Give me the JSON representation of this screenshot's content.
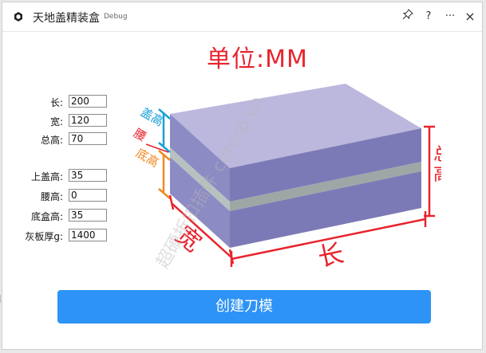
{
  "window": {
    "title": "天地盖精装盒",
    "build_tag": "Debug",
    "controls": {
      "pin": "pin-icon",
      "help": "?",
      "more": "···",
      "close": "×"
    }
  },
  "form": {
    "fields": [
      {
        "label": "长:",
        "value": "200"
      },
      {
        "label": "宽:",
        "value": "120"
      },
      {
        "label": "总高:",
        "value": "70"
      },
      {
        "label": "上盖高:",
        "value": "35"
      },
      {
        "label": "腰高:",
        "value": "0"
      },
      {
        "label": "底盒高:",
        "value": "35"
      },
      {
        "label": "灰板厚g:",
        "value": "1400"
      }
    ]
  },
  "diagram": {
    "unit_title": "单位:MM",
    "labels": {
      "lid": "盖高",
      "waist": "腰",
      "base": "底高",
      "total": "总高",
      "width": "宽",
      "length": "长"
    },
    "watermark": "超硬折扣插件 cdrccp.cn",
    "colors": {
      "dimension_red": "#e8242e",
      "lid_blue": "#1aa0d8",
      "base_orange": "#ef8a22",
      "box_top": "#bcb8dd",
      "box_side": "#7c7ab6",
      "box_front": "#8d8bc4",
      "waist_band": "#9ea7a6"
    }
  },
  "actions": {
    "create_label": "创建刀模"
  }
}
